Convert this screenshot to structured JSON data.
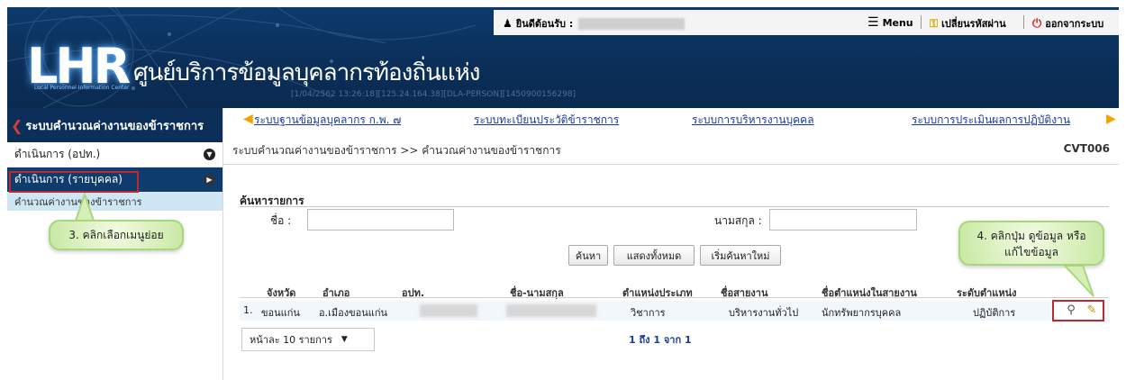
{
  "header": {
    "logo_text": "LHR",
    "logo_sub": "Local Personnel Information Center",
    "site_title": "ศูนย์บริการข้อมูลบุคลากรท้องถิ่นแห่ง",
    "server_info": "[1/04/2562 13:26:18][125.24.164.38][DLA-PERSON][1450900156298]",
    "welcome_label": "ยินดีต้อนรับ :",
    "menu_label": "Menu",
    "change_password_label": "เปลี่ยนรหัสผ่าน",
    "logout_label": "ออกจากระบบ"
  },
  "sidebar": {
    "title": "ระบบคำนวณค่างานของข้าราชการ",
    "items": [
      {
        "label": "ดำเนินการ (อปท.)"
      },
      {
        "label": "ดำเนินการ (รายบุคคล)"
      }
    ],
    "sub_item": "คำนวณค่างานของข้าราชการ"
  },
  "nav": {
    "links": [
      "ระบบฐานข้อมูลบุคลากร ก.พ. ๗",
      "ระบบทะเบียนประวัติข้าราชการ",
      "ระบบการบริหารงานบุคคล",
      "ระบบการประเมินผลการปฏิบัติงาน"
    ]
  },
  "main": {
    "breadcrumb": "ระบบคำนวณค่างานของข้าราชการ >> คำนวณค่างานของข้าราชการ",
    "code": "CVT006",
    "search_title": "ค้นหารายการ",
    "first_name_label": "ชื่อ :",
    "first_name_value": "",
    "last_name_label": "นามสกุล :",
    "last_name_value": "",
    "btn_search": "ค้นหา",
    "btn_show_all": "แสดงทั้งหมด",
    "btn_reset": "เริ่มค้นหาใหม่",
    "columns": [
      "จังหวัด",
      "อำเภอ",
      "อปท.",
      "ชื่อ-นามสกุล",
      "ตำแหน่งประเภท",
      "ชื่อสายงาน",
      "ชื่อตำแหน่งในสายงาน",
      "ระดับตำแหน่ง"
    ],
    "rows": [
      {
        "no": "1.",
        "province": "ขอนแก่น",
        "district": "อ.เมืองขอนแก่น",
        "type": "วิชาการ",
        "line": "บริหารงานทั่วไป",
        "position": "นักทรัพยากรบุคคล",
        "level": "ปฏิบัติการ"
      }
    ],
    "page_size": "หน้าละ 10 รายการ",
    "page_info": "1 ถึง 1 จาก 1"
  },
  "callouts": {
    "left": "3. คลิกเลือกเมนูย่อย",
    "right_line1": "4. คลิกปุ่ม ดูข้อมูล หรือ",
    "right_line2": "แก้ไขข้อมูล"
  }
}
